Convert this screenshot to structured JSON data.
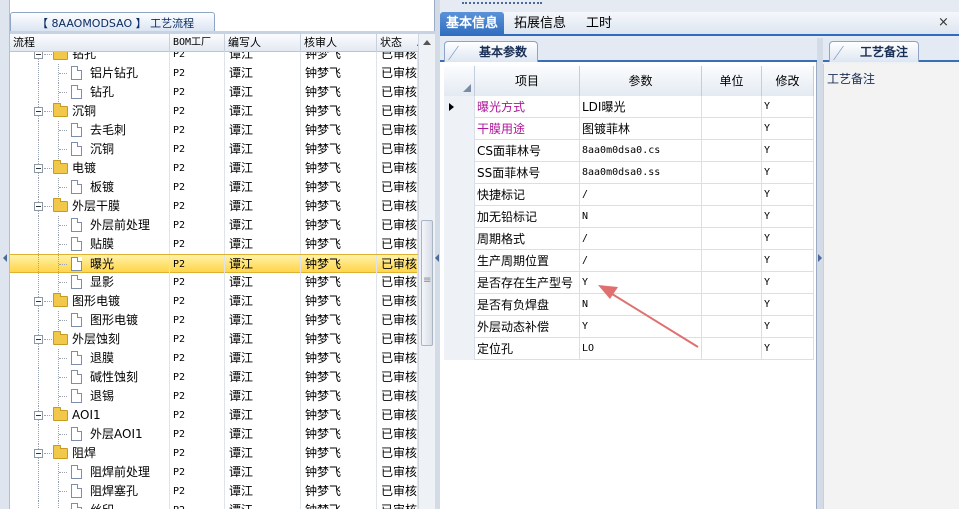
{
  "left_panel": {
    "title": "【 8AAOMODSAO 】 工艺流程",
    "columns": [
      "流程",
      "BOM工厂",
      "编写人",
      "核审人",
      "状态"
    ],
    "rows": [
      {
        "level": 1,
        "type": "folder",
        "name": "钻孔",
        "bom": "P2",
        "writer": "谭江",
        "reviewer": "钟梦飞",
        "status": "已审核"
      },
      {
        "level": 2,
        "type": "doc",
        "name": "铝片钻孔",
        "bom": "P2",
        "writer": "谭江",
        "reviewer": "钟梦飞",
        "status": "已审核"
      },
      {
        "level": 2,
        "type": "doc",
        "name": "钻孔",
        "bom": "P2",
        "writer": "谭江",
        "reviewer": "钟梦飞",
        "status": "已审核"
      },
      {
        "level": 1,
        "type": "folder",
        "name": "沉铜",
        "bom": "P2",
        "writer": "谭江",
        "reviewer": "钟梦飞",
        "status": "已审核"
      },
      {
        "level": 2,
        "type": "doc",
        "name": "去毛刺",
        "bom": "P2",
        "writer": "谭江",
        "reviewer": "钟梦飞",
        "status": "已审核"
      },
      {
        "level": 2,
        "type": "doc",
        "name": "沉铜",
        "bom": "P2",
        "writer": "谭江",
        "reviewer": "钟梦飞",
        "status": "已审核"
      },
      {
        "level": 1,
        "type": "folder",
        "name": "电镀",
        "bom": "P2",
        "writer": "谭江",
        "reviewer": "钟梦飞",
        "status": "已审核"
      },
      {
        "level": 2,
        "type": "doc",
        "name": "板镀",
        "bom": "P2",
        "writer": "谭江",
        "reviewer": "钟梦飞",
        "status": "已审核"
      },
      {
        "level": 1,
        "type": "folder",
        "name": "外层干膜",
        "bom": "P2",
        "writer": "谭江",
        "reviewer": "钟梦飞",
        "status": "已审核"
      },
      {
        "level": 2,
        "type": "doc",
        "name": "外层前处理",
        "bom": "P2",
        "writer": "谭江",
        "reviewer": "钟梦飞",
        "status": "已审核"
      },
      {
        "level": 2,
        "type": "doc",
        "name": "贴膜",
        "bom": "P2",
        "writer": "谭江",
        "reviewer": "钟梦飞",
        "status": "已审核"
      },
      {
        "level": 2,
        "type": "doc",
        "name": "曝光",
        "bom": "P2",
        "writer": "谭江",
        "reviewer": "钟梦飞",
        "status": "已审核",
        "selected": true
      },
      {
        "level": 2,
        "type": "doc",
        "name": "显影",
        "bom": "P2",
        "writer": "谭江",
        "reviewer": "钟梦飞",
        "status": "已审核"
      },
      {
        "level": 1,
        "type": "folder",
        "name": "图形电镀",
        "bom": "P2",
        "writer": "谭江",
        "reviewer": "钟梦飞",
        "status": "已审核"
      },
      {
        "level": 2,
        "type": "doc",
        "name": "图形电镀",
        "bom": "P2",
        "writer": "谭江",
        "reviewer": "钟梦飞",
        "status": "已审核"
      },
      {
        "level": 1,
        "type": "folder",
        "name": "外层蚀刻",
        "bom": "P2",
        "writer": "谭江",
        "reviewer": "钟梦飞",
        "status": "已审核"
      },
      {
        "level": 2,
        "type": "doc",
        "name": "退膜",
        "bom": "P2",
        "writer": "谭江",
        "reviewer": "钟梦飞",
        "status": "已审核"
      },
      {
        "level": 2,
        "type": "doc",
        "name": "碱性蚀刻",
        "bom": "P2",
        "writer": "谭江",
        "reviewer": "钟梦飞",
        "status": "已审核"
      },
      {
        "level": 2,
        "type": "doc",
        "name": "退锡",
        "bom": "P2",
        "writer": "谭江",
        "reviewer": "钟梦飞",
        "status": "已审核"
      },
      {
        "level": 1,
        "type": "folder",
        "name": "AOI1",
        "bom": "P2",
        "writer": "谭江",
        "reviewer": "钟梦飞",
        "status": "已审核"
      },
      {
        "level": 2,
        "type": "doc",
        "name": "外层AOI1",
        "bom": "P2",
        "writer": "谭江",
        "reviewer": "钟梦飞",
        "status": "已审核"
      },
      {
        "level": 1,
        "type": "folder",
        "name": "阻焊",
        "bom": "P2",
        "writer": "谭江",
        "reviewer": "钟梦飞",
        "status": "已审核"
      },
      {
        "level": 2,
        "type": "doc",
        "name": "阻焊前处理",
        "bom": "P2",
        "writer": "谭江",
        "reviewer": "钟梦飞",
        "status": "已审核"
      },
      {
        "level": 2,
        "type": "doc",
        "name": "阻焊塞孔",
        "bom": "P2",
        "writer": "谭江",
        "reviewer": "钟梦飞",
        "status": "已审核"
      },
      {
        "level": 2,
        "type": "doc",
        "name": "丝印",
        "bom": "P2",
        "writer": "谭江",
        "reviewer": "钟梦飞",
        "status": "已审核"
      }
    ]
  },
  "main_tabs": [
    {
      "label": "基本信息",
      "active": true
    },
    {
      "label": "拓展信息",
      "active": false
    },
    {
      "label": "工时",
      "active": false
    }
  ],
  "close_label": "×",
  "params": {
    "tab_label": "基本参数",
    "columns": [
      "项目",
      "参数",
      "单位",
      "修改"
    ],
    "rows": [
      {
        "item": "曝光方式",
        "value": "LDI曝光",
        "unit": "",
        "modify": "Y",
        "required": true,
        "current": true
      },
      {
        "item": "干膜用途",
        "value": "图镀菲林",
        "unit": "",
        "modify": "Y",
        "required": true
      },
      {
        "item": "CS面菲林号",
        "value": "8aa0m0dsa0.cs",
        "unit": "",
        "modify": "Y"
      },
      {
        "item": "SS面菲林号",
        "value": "8aa0m0dsa0.ss",
        "unit": "",
        "modify": "Y"
      },
      {
        "item": "快捷标记",
        "value": "/",
        "unit": "",
        "modify": "Y"
      },
      {
        "item": "加无铅标记",
        "value": "N",
        "unit": "",
        "modify": "Y"
      },
      {
        "item": "周期格式",
        "value": "/",
        "unit": "",
        "modify": "Y"
      },
      {
        "item": "生产周期位置",
        "value": "/",
        "unit": "",
        "modify": "Y"
      },
      {
        "item": "是否存在生产型号",
        "value": "Y",
        "unit": "",
        "modify": "Y"
      },
      {
        "item": "是否有负焊盘",
        "value": "N",
        "unit": "",
        "modify": "Y"
      },
      {
        "item": "外层动态补偿",
        "value": "Y",
        "unit": "",
        "modify": "Y"
      },
      {
        "item": "定位孔",
        "value": "LO",
        "unit": "",
        "modify": "Y"
      }
    ]
  },
  "notes": {
    "tab_label": "工艺备注",
    "label": "工艺备注"
  },
  "colors": {
    "accent": "#2f6cc0",
    "required_text": "#b0149a",
    "selected_row": "#ffd54a",
    "annotation_arrow": "#e07070"
  }
}
